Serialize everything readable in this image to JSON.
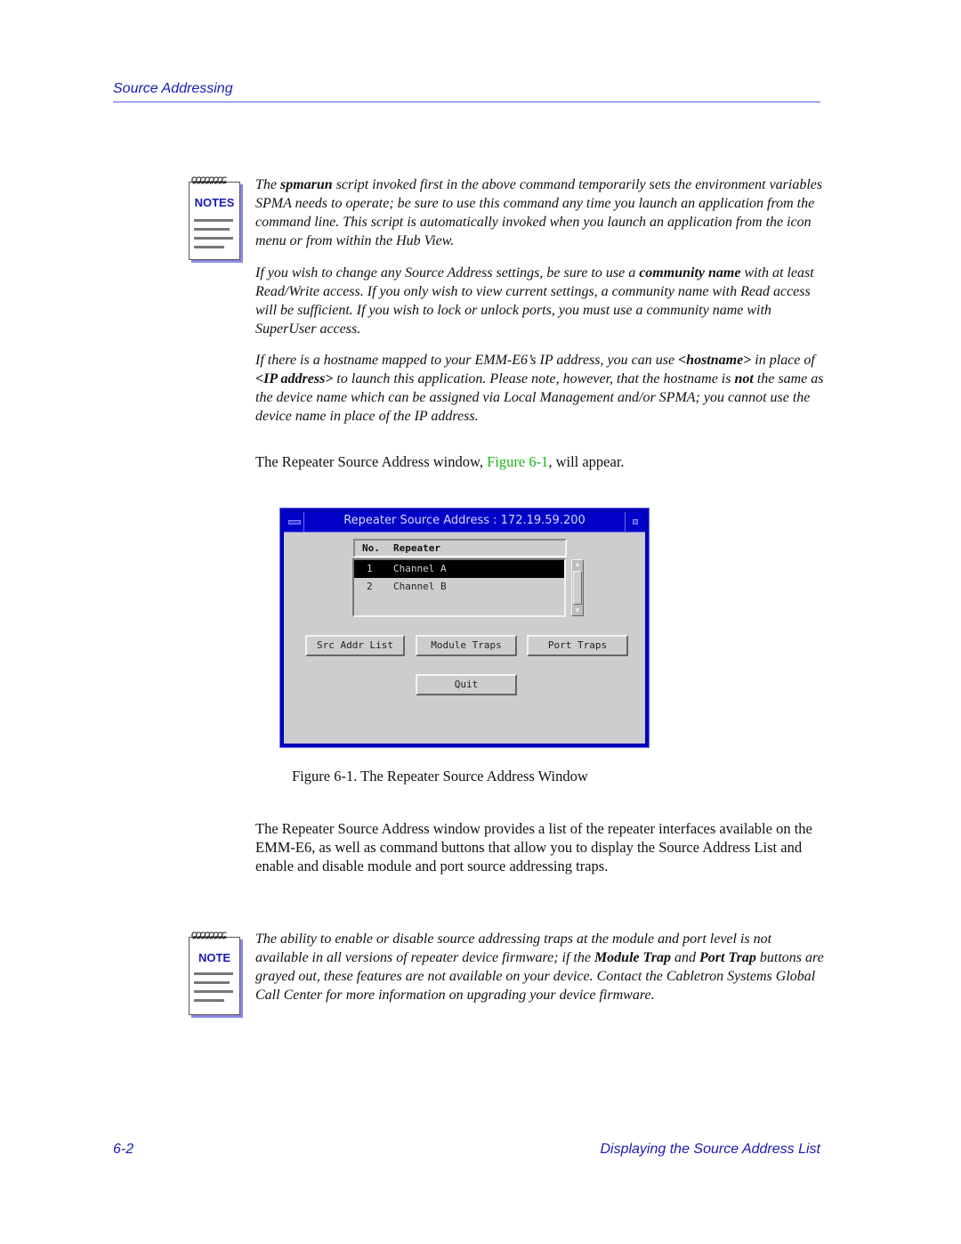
{
  "header": {
    "running_head": "Source Addressing"
  },
  "notes_1": {
    "icon_label": "NOTES",
    "p1": {
      "a": "The ",
      "b": "spmarun",
      "c": " script invoked first in the above command temporarily sets the environment variables SPMA needs to operate; be sure to use this command any time you launch an application from the command line. This script is automatically invoked when you launch an application from the icon menu or from within the Hub View."
    },
    "p2": {
      "a": "If you wish to change any Source Address settings, be sure to use a ",
      "b": "community name",
      "c": " with at least Read/Write access. If you only wish to view current settings, a community name with Read access will be sufficient. If you wish to lock or unlock ports, you must use a community name with SuperUser access."
    },
    "p3": {
      "a": "If there is a hostname mapped to your EMM-E6’s IP address, you can use ",
      "b": "<hostname>",
      "c": " in place of ",
      "d": "<IP address>",
      "e": " to launch this application. Please note, however, that the hostname is ",
      "f": "not",
      "g": " the same as the device name which can be assigned via Local Management and/or SPMA; you cannot use the device name in place of the IP address."
    }
  },
  "intro": {
    "a": "The Repeater Source Address window, ",
    "link": "Figure 6-1",
    "b": ", will appear."
  },
  "window": {
    "title": "Repeater Source Address : 172.19.59.200",
    "list_headers": [
      "No.",
      "Repeater"
    ],
    "rows": [
      {
        "no": "1",
        "repeater": "Channel A",
        "selected": true
      },
      {
        "no": "2",
        "repeater": "Channel B",
        "selected": false
      }
    ],
    "scroll_up": "▲",
    "scroll_down": "▼",
    "buttons": {
      "src_addr_list": "Src Addr List",
      "module_traps": "Module Traps",
      "port_traps": "Port Traps",
      "quit": "Quit"
    }
  },
  "caption": "Figure 6-1.  The Repeater Source Address Window",
  "body_para": "The Repeater Source Address window provides a list of the repeater interfaces available on the EMM-E6, as well as command buttons that allow you to display the Source Address List and enable and disable module and port source addressing traps.",
  "note_2": {
    "icon_label": "NOTE",
    "a": "The ability to enable or disable source addressing traps at the module and port level is not available in all versions of repeater device firmware; if the ",
    "b": "Module Trap",
    "c": " and ",
    "d": "Port Trap",
    "e": " buttons are grayed out, these features are not available on your device. Contact the Cabletron Systems Global Call Center for more information on upgrading your device firmware."
  },
  "footer": {
    "page_number": "6-2",
    "section_title": "Displaying the Source Address List"
  },
  "colors": {
    "heading_blue": "#1a1ab8",
    "link_green": "#1eb41e",
    "window_blue": "#0000b8",
    "window_gray": "#cdcdcd"
  }
}
